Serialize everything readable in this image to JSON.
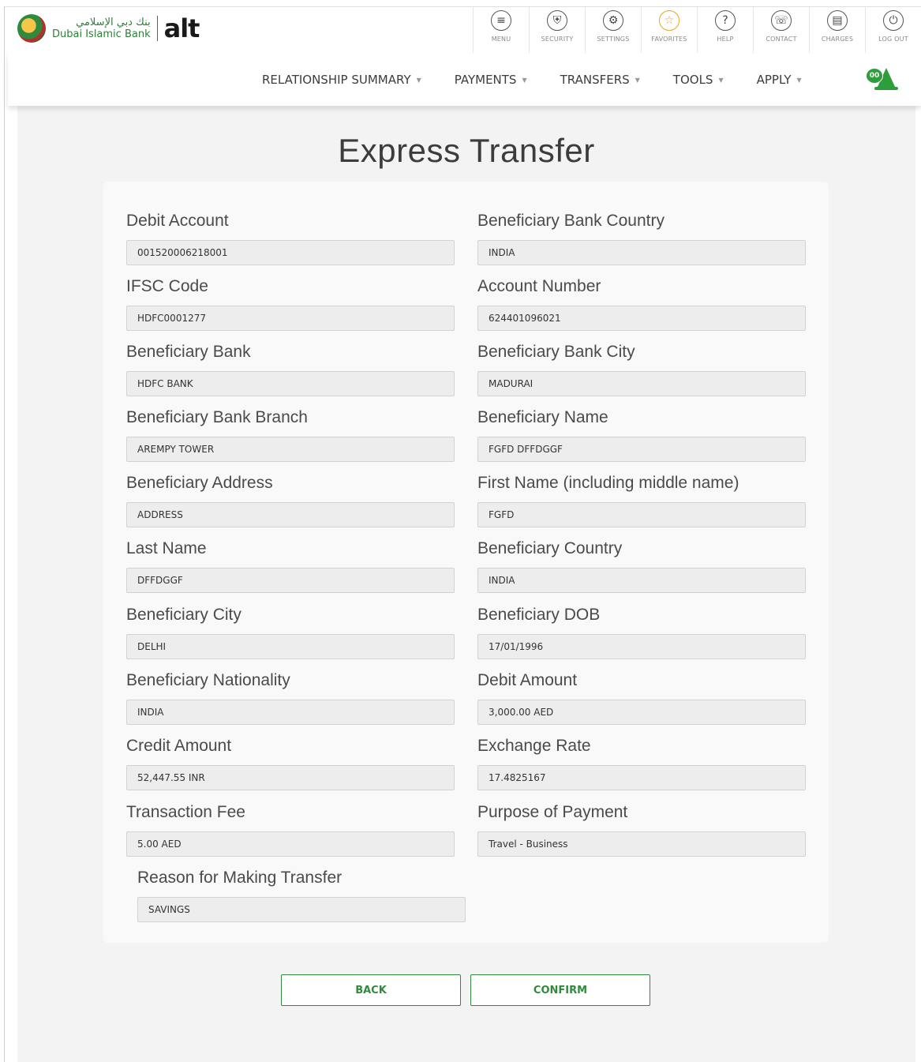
{
  "brand": {
    "arabic_name": "بنك دبي الإسلامي",
    "english_name": "Dubai Islamic Bank",
    "product": "alt"
  },
  "topnav": [
    {
      "label": "MENU",
      "icon": "menu-icon",
      "glyph": "≡"
    },
    {
      "label": "SECURITY",
      "icon": "security-icon",
      "glyph": "⛨"
    },
    {
      "label": "SETTINGS",
      "icon": "settings-icon",
      "glyph": "⚙"
    },
    {
      "label": "FAVORITES",
      "icon": "favorites-icon",
      "glyph": "☆"
    },
    {
      "label": "HELP",
      "icon": "help-icon",
      "glyph": "?"
    },
    {
      "label": "CONTACT",
      "icon": "contact-icon",
      "glyph": "☏"
    },
    {
      "label": "CHARGES",
      "icon": "charges-icon",
      "glyph": "▤"
    },
    {
      "label": "LOG OUT",
      "icon": "logout-icon",
      "glyph": "⏻"
    }
  ],
  "menu": [
    {
      "label": "RELATIONSHIP SUMMARY"
    },
    {
      "label": "PAYMENTS"
    },
    {
      "label": "TRANSFERS"
    },
    {
      "label": "TOOLS"
    },
    {
      "label": "APPLY"
    }
  ],
  "notifications": {
    "count": "00"
  },
  "page": {
    "title": "Express Transfer"
  },
  "fields": [
    {
      "label": "Debit Account",
      "value": "001520006218001"
    },
    {
      "label": "Beneficiary Bank Country",
      "value": "INDIA"
    },
    {
      "label": "IFSC Code",
      "value": "HDFC0001277"
    },
    {
      "label": "Account Number",
      "value": "624401096021"
    },
    {
      "label": "Beneficiary Bank",
      "value": "HDFC BANK"
    },
    {
      "label": "Beneficiary Bank City",
      "value": "MADURAI"
    },
    {
      "label": "Beneficiary Bank Branch",
      "value": "AREMPY TOWER"
    },
    {
      "label": "Beneficiary Name",
      "value": "FGFD DFFDGGF"
    },
    {
      "label": "Beneficiary Address",
      "value": "ADDRESS"
    },
    {
      "label": "First Name (including middle name)",
      "value": "FGFD"
    },
    {
      "label": "Last Name",
      "value": "DFFDGGF"
    },
    {
      "label": "Beneficiary Country",
      "value": "INDIA"
    },
    {
      "label": "Beneficiary City",
      "value": "DELHI"
    },
    {
      "label": "Beneficiary DOB",
      "value": "17/01/1996"
    },
    {
      "label": "Beneficiary Nationality",
      "value": "INDIA"
    },
    {
      "label": "Debit Amount",
      "value": "3,000.00 AED"
    },
    {
      "label": "Credit Amount",
      "value": "52,447.55 INR"
    },
    {
      "label": "Exchange Rate",
      "value": "17.4825167"
    },
    {
      "label": "Transaction Fee",
      "value": "5.00 AED"
    },
    {
      "label": "Purpose of Payment",
      "value": "Travel - Business"
    },
    {
      "label": "Reason for Making Transfer",
      "value": "SAVINGS"
    }
  ],
  "actions": {
    "back_label": "BACK",
    "confirm_label": "CONFIRM"
  },
  "colors": {
    "brand_green": "#2f8a3e",
    "field_bg": "#ededed",
    "page_bg": "#f3f3f3"
  }
}
